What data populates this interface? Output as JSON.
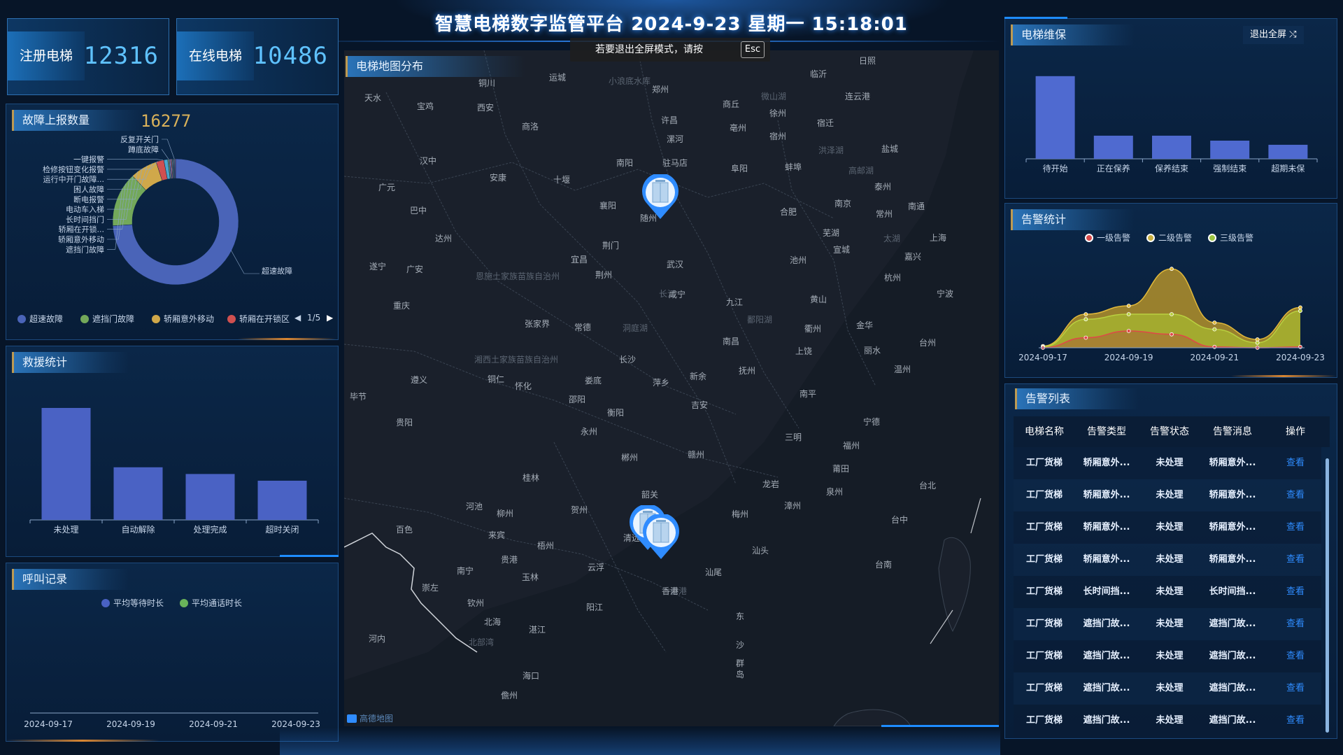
{
  "header": {
    "title": "智慧电梯数字监管平台  2024-9-23 星期一 15:18:01"
  },
  "fullscreen_tip": {
    "text": "若要退出全屏模式，请按",
    "key": "Esc"
  },
  "stats": [
    {
      "label": "注册电梯",
      "value": "12316"
    },
    {
      "label": "在线电梯",
      "value": "10486"
    }
  ],
  "fault": {
    "title": "故障上报数量",
    "count": "16277",
    "chart_data": {
      "type": "pie",
      "categories": [
        "超速故障",
        "遮挡门故障",
        "轿厢意外移动",
        "轿厢在开锁区",
        "反复开关门",
        "蹲底故障",
        "一键报警",
        "检修按钮变化报警",
        "运行中开门故障",
        "困人故障",
        "断电报警",
        "电动车入梯",
        "长时间挡门"
      ],
      "values": [
        74,
        14,
        7,
        2,
        1,
        0.4,
        0.3,
        0.3,
        0.2,
        0.2,
        0.2,
        0.2,
        0.2
      ],
      "colors": [
        "#4a64b8",
        "#73a85a",
        "#d0a84a",
        "#d05050",
        "#4aa6cc",
        "#6a8a6a",
        "#8a7bd0",
        "#c07070",
        "#5a9ad0",
        "#a0a060",
        "#7070b0",
        "#60a0a0",
        "#a06090"
      ]
    },
    "labels_left": [
      "反复开关门",
      "蹲底故障",
      "一键报警",
      "检修按钮变化报警",
      "运行中开门故障...",
      "困人故障",
      "断电报警",
      "电动车入梯",
      "长时间挡门",
      "轿厢在开锁...",
      "轿厢意外移动",
      "遮挡门故障"
    ],
    "label_right": "超速故障",
    "legend": [
      "超速故障",
      "遮挡门故障",
      "轿厢意外移动",
      "轿厢在开锁区"
    ],
    "pager": "1/5"
  },
  "rescue": {
    "title": "救援统计",
    "chart_data": {
      "type": "bar",
      "categories": [
        "未处理",
        "自动解除",
        "处理完成",
        "超时关闭"
      ],
      "values": [
        100,
        47,
        41,
        35
      ],
      "ylim": [
        0,
        110
      ],
      "color": "#4a62c4"
    }
  },
  "call": {
    "title": "呼叫记录",
    "legend": [
      "平均等待时长",
      "平均通话时长"
    ],
    "legend_colors": [
      "#4a62c4",
      "#6ab35a"
    ],
    "chart_data": {
      "type": "line",
      "x": [
        "2024-09-17",
        "2024-09-19",
        "2024-09-21",
        "2024-09-23"
      ]
    }
  },
  "map": {
    "title": "电梯地图分布",
    "attribution": "高德地图",
    "cities": [
      [
        "天水",
        533,
        139
      ],
      [
        "宝鸡",
        608,
        151
      ],
      [
        "西安",
        694,
        153
      ],
      [
        "铜川",
        696,
        118
      ],
      [
        "运城",
        797,
        110
      ],
      [
        "郑州",
        944,
        127
      ],
      [
        "商丘",
        1045,
        148
      ],
      [
        "临沂",
        1170,
        105
      ],
      [
        "日照",
        1240,
        86
      ],
      [
        "连云港",
        1226,
        137
      ],
      [
        "徐州",
        1112,
        161
      ],
      [
        "宿迁",
        1180,
        175
      ],
      [
        "宿州",
        1112,
        194
      ],
      [
        "亳州",
        1055,
        182
      ],
      [
        "许昌",
        957,
        171
      ],
      [
        "漯河",
        965,
        198
      ],
      [
        "商洛",
        758,
        180
      ],
      [
        "汉中",
        612,
        229
      ],
      [
        "安康",
        712,
        253
      ],
      [
        "南阳",
        893,
        232
      ],
      [
        "驻马店",
        965,
        232
      ],
      [
        "阜阳",
        1057,
        240
      ],
      [
        "蚌埠",
        1134,
        238
      ],
      [
        "盐城",
        1272,
        212
      ],
      [
        "泰州",
        1262,
        266
      ],
      [
        "十堰",
        803,
        256
      ],
      [
        "广元",
        553,
        267
      ],
      [
        "巴中",
        598,
        300
      ],
      [
        "合肥",
        1127,
        302
      ],
      [
        "南京",
        1205,
        290
      ],
      [
        "常州",
        1264,
        305
      ],
      [
        "南通",
        1310,
        294
      ],
      [
        "达州",
        634,
        340
      ],
      [
        "襄阳",
        869,
        293
      ],
      [
        "随州",
        927,
        311
      ],
      [
        "芜湖",
        1188,
        332
      ],
      [
        "宣城",
        1203,
        356
      ],
      [
        "上海",
        1341,
        339
      ],
      [
        "嘉兴",
        1305,
        366
      ],
      [
        "荆门",
        873,
        350
      ],
      [
        "宜昌",
        828,
        370
      ],
      [
        "武汉",
        965,
        377
      ],
      [
        "池州",
        1141,
        371
      ],
      [
        "遂宁",
        540,
        380
      ],
      [
        "广安",
        593,
        384
      ],
      [
        "荆州",
        863,
        392
      ],
      [
        "杭州",
        1276,
        396
      ],
      [
        "宁波",
        1351,
        419
      ],
      [
        "重庆",
        574,
        436
      ],
      [
        "咸宁",
        968,
        420
      ],
      [
        "九江",
        1050,
        431
      ],
      [
        "黄山",
        1170,
        427
      ],
      [
        "张家界",
        768,
        462
      ],
      [
        "常德",
        833,
        467
      ],
      [
        "衢州",
        1162,
        469
      ],
      [
        "金华",
        1236,
        464
      ],
      [
        "南昌",
        1045,
        487
      ],
      [
        "上饶",
        1149,
        501
      ],
      [
        "丽水",
        1247,
        500
      ],
      [
        "台州",
        1326,
        489
      ],
      [
        "长沙",
        897,
        513
      ],
      [
        "遵义",
        599,
        542
      ],
      [
        "铜仁",
        709,
        541
      ],
      [
        "怀化",
        748,
        551
      ],
      [
        "娄底",
        848,
        543
      ],
      [
        "萍乡",
        945,
        546
      ],
      [
        "新余",
        998,
        537
      ],
      [
        "抚州",
        1068,
        529
      ],
      [
        "温州",
        1290,
        527
      ],
      [
        "毕节",
        512,
        566
      ],
      [
        "邵阳",
        825,
        570
      ],
      [
        "衡阳",
        880,
        589
      ],
      [
        "吉安",
        1000,
        578
      ],
      [
        "南平",
        1155,
        562
      ],
      [
        "贵阳",
        578,
        603
      ],
      [
        "永州",
        842,
        616
      ],
      [
        "宁德",
        1246,
        602
      ],
      [
        "三明",
        1134,
        624
      ],
      [
        "福州",
        1217,
        636
      ],
      [
        "郴州",
        900,
        653
      ],
      [
        "赣州",
        995,
        649
      ],
      [
        "莆田",
        1202,
        669
      ],
      [
        "桂林",
        759,
        682
      ],
      [
        "龙岩",
        1102,
        691
      ],
      [
        "泉州",
        1193,
        702
      ],
      [
        "韶关",
        929,
        706
      ],
      [
        "河池",
        678,
        723
      ],
      [
        "柳州",
        722,
        733
      ],
      [
        "贺州",
        828,
        728
      ],
      [
        "梅州",
        1058,
        734
      ],
      [
        "漳州",
        1133,
        722
      ],
      [
        "百色",
        578,
        756
      ],
      [
        "来宾",
        710,
        764
      ],
      [
        "清远",
        903,
        768
      ],
      [
        "台北",
        1326,
        693
      ],
      [
        "台中",
        1286,
        742
      ],
      [
        "贵港",
        728,
        799
      ],
      [
        "梧州",
        780,
        779
      ],
      [
        "汕头",
        1087,
        786
      ],
      [
        "南宁",
        665,
        815
      ],
      [
        "玉林",
        758,
        824
      ],
      [
        "云浮",
        852,
        810
      ],
      [
        "汕尾",
        1020,
        817
      ],
      [
        "香港",
        958,
        844
      ],
      [
        "崇左",
        615,
        839
      ],
      [
        "钦州",
        680,
        861
      ],
      [
        "北海",
        704,
        888
      ],
      [
        "阳江",
        850,
        867
      ],
      [
        "台南",
        1263,
        806
      ],
      [
        "湛江",
        768,
        899
      ],
      [
        "河内",
        539,
        912
      ],
      [
        "海口",
        759,
        965
      ],
      [
        "儋州",
        728,
        993
      ],
      [
        "东",
        1058,
        880
      ],
      [
        "沙",
        1058,
        921
      ],
      [
        "群",
        1058,
        947
      ],
      [
        "岛",
        1058,
        963
      ]
    ],
    "cities_dim": [
      [
        "小浪底水库",
        870,
        115
      ],
      [
        "微山湖",
        1088,
        137
      ],
      [
        "洪泽湖",
        1170,
        214
      ],
      [
        "高邮湖",
        1213,
        243
      ],
      [
        "太湖",
        1263,
        340
      ],
      [
        "长江",
        942,
        419
      ],
      [
        "洞庭湖",
        890,
        468
      ],
      [
        "鄱阳湖",
        1068,
        456
      ],
      [
        "湘西土家族苗族自治州",
        678,
        513
      ],
      [
        "恩施土家族苗族自治州",
        680,
        394
      ],
      [
        "北部湾",
        670,
        917
      ],
      [
        "香港",
        958,
        844
      ]
    ],
    "markers": [
      [
        944,
        279
      ],
      [
        926,
        752
      ],
      [
        945,
        765
      ]
    ]
  },
  "maintenance": {
    "title": "电梯维保",
    "exit_label": "退出全屏",
    "chart_data": {
      "type": "bar",
      "categories": [
        "待开始",
        "正在保养",
        "保养结束",
        "强制结束",
        "超期未保"
      ],
      "values": [
        100,
        28,
        28,
        22,
        17
      ],
      "ylim": [
        0,
        110
      ],
      "color": "#4f6ad0"
    }
  },
  "alarm_stats": {
    "title": "告警统计",
    "legend": [
      "一级告警",
      "二级告警",
      "三级告警"
    ],
    "legend_colors": [
      "#d84a4a",
      "#c9b040",
      "#9ac340"
    ],
    "chart_data": {
      "type": "area",
      "x": [
        "2024-09-17",
        "2024-09-18",
        "2024-09-19",
        "2024-09-20",
        "2024-09-21",
        "2024-09-22",
        "2024-09-23"
      ],
      "x_ticks": [
        "2024-09-17",
        "2024-09-19",
        "2024-09-21",
        "2024-09-23"
      ],
      "series": [
        {
          "name": "三级告警",
          "values": [
            2,
            40,
            50,
            94,
            30,
            10,
            48
          ]
        },
        {
          "name": "二级告警",
          "values": [
            1,
            34,
            40,
            40,
            22,
            6,
            44
          ]
        },
        {
          "name": "一级告警",
          "values": [
            0,
            12,
            20,
            16,
            1,
            0,
            1
          ]
        }
      ],
      "ylim": [
        0,
        100
      ]
    }
  },
  "alarm_list": {
    "title": "告警列表",
    "columns": [
      "电梯名称",
      "告警类型",
      "告警状态",
      "告警消息",
      "操作"
    ],
    "rows": [
      [
        "工厂货梯",
        "轿厢意外...",
        "未处理",
        "轿厢意外...",
        "查看"
      ],
      [
        "工厂货梯",
        "轿厢意外...",
        "未处理",
        "轿厢意外...",
        "查看"
      ],
      [
        "工厂货梯",
        "轿厢意外...",
        "未处理",
        "轿厢意外...",
        "查看"
      ],
      [
        "工厂货梯",
        "轿厢意外...",
        "未处理",
        "轿厢意外...",
        "查看"
      ],
      [
        "工厂货梯",
        "长时间挡...",
        "未处理",
        "长时间挡...",
        "查看"
      ],
      [
        "工厂货梯",
        "遮挡门故...",
        "未处理",
        "遮挡门故...",
        "查看"
      ],
      [
        "工厂货梯",
        "遮挡门故...",
        "未处理",
        "遮挡门故...",
        "查看"
      ],
      [
        "工厂货梯",
        "遮挡门故...",
        "未处理",
        "遮挡门故...",
        "查看"
      ],
      [
        "工厂货梯",
        "遮挡门故...",
        "未处理",
        "遮挡门故...",
        "查看"
      ]
    ]
  }
}
